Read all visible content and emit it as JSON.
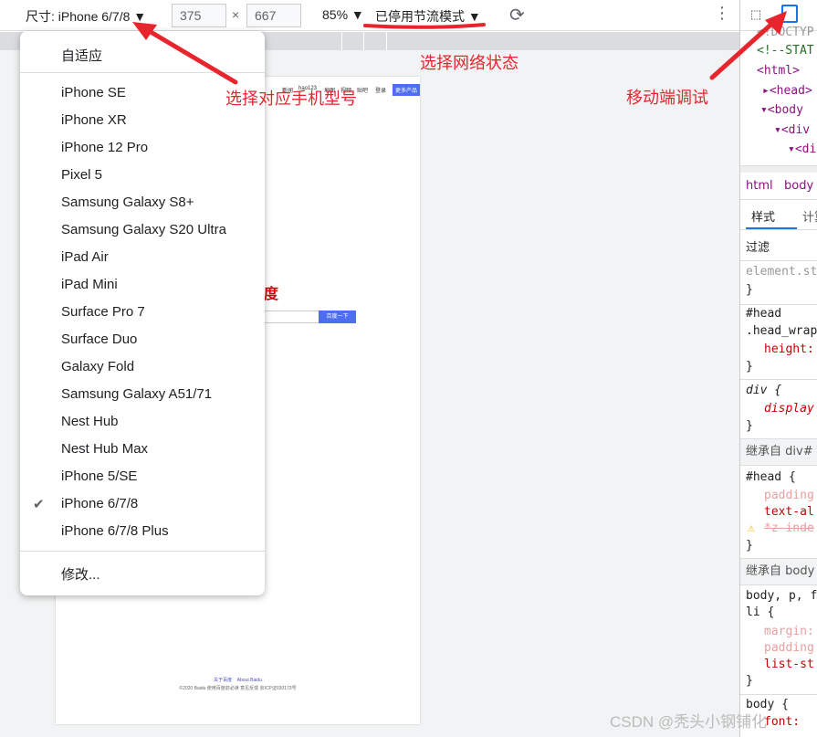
{
  "toolbar": {
    "size_label": "尺寸: iPhone 6/7/8 ▼",
    "width": "375",
    "times": "×",
    "height": "667",
    "zoom": "85% ▼",
    "throttle": "已停用节流模式 ▼",
    "rotate_icon": "rotate-icon",
    "more_icon": "more-vertical-icon"
  },
  "menu": {
    "responsive": "自适应",
    "devices": [
      "iPhone SE",
      "iPhone XR",
      "iPhone 12 Pro",
      "Pixel 5",
      "Samsung Galaxy S8+",
      "Samsung Galaxy S20 Ultra",
      "iPad Air",
      "iPad Mini",
      "Surface Pro 7",
      "Surface Duo",
      "Galaxy Fold",
      "Samsung Galaxy A51/71",
      "Nest Hub",
      "Nest Hub Max",
      "iPhone 5/SE",
      "iPhone 6/7/8",
      "iPhone 6/7/8 Plus"
    ],
    "selected": "iPhone 6/7/8",
    "check": "✔",
    "edit": "修改..."
  },
  "page": {
    "nav": [
      "新闻",
      "hao123",
      "地图",
      "视频",
      "贴吧",
      "登录"
    ],
    "more": "更多产品",
    "logo": "度",
    "search_btn": "百度一下",
    "footer_links": [
      "关于百度",
      "About Baidu"
    ],
    "footer_copy": "©2020 Baidu 使用百度前必读 意见反馈 京ICP证030173号"
  },
  "annotations": {
    "device": "选择对应手机型号",
    "network": "选择网络状态",
    "mobile": "移动端调试"
  },
  "devtools": {
    "elements": [
      "<!DOCTYP",
      "<!--STAT",
      "<html>",
      "<head>",
      "<body",
      "<div",
      "<di"
    ],
    "breadcrumb": [
      "html",
      "body"
    ],
    "tabs": [
      "样式",
      "计算"
    ],
    "filter": "过滤",
    "element_style": "element.st",
    "rules": [
      "#head",
      ".head_wrap",
      "height:",
      "div {",
      "display",
      "继承自 div#",
      "#head {",
      "padding",
      "text-al",
      "*z-inde",
      "继承自 body",
      "body, p, f",
      "li {",
      "margin:",
      "padding",
      "list-st",
      "body {",
      "font:"
    ]
  },
  "watermark": "CSDN @秃头小钢铺化"
}
